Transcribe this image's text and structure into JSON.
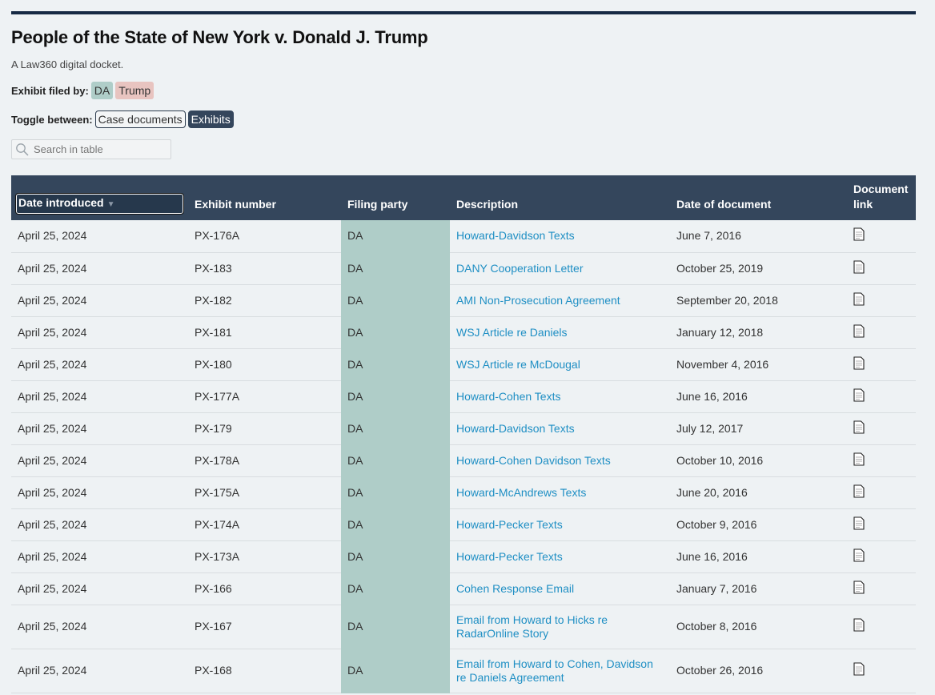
{
  "header": {
    "title": "People of the State of New York v. Donald J. Trump",
    "subtitle": "A Law360 digital docket."
  },
  "legend": {
    "label": "Exhibit filed by:",
    "chips": [
      {
        "label": "DA",
        "color": "#afcdc8"
      },
      {
        "label": "Trump",
        "color": "#e8c4c0"
      }
    ]
  },
  "toggle": {
    "label": "Toggle between:",
    "options": [
      "Case documents",
      "Exhibits"
    ],
    "selected": "Exhibits"
  },
  "search": {
    "placeholder": "Search in table",
    "value": ""
  },
  "table": {
    "columns": [
      "Date introduced",
      "Exhibit number",
      "Filing party",
      "Description",
      "Date of document",
      "Document link"
    ],
    "sort_column": "Date introduced",
    "sort_direction": "descending",
    "rows": [
      {
        "date_introduced": "April 25, 2024",
        "exhibit": "PX-176A",
        "party": "DA",
        "description": "Howard-Davidson Texts",
        "doc_date": "June 7, 2016"
      },
      {
        "date_introduced": "April 25, 2024",
        "exhibit": "PX-183",
        "party": "DA",
        "description": "DANY Cooperation Letter",
        "doc_date": "October 25, 2019"
      },
      {
        "date_introduced": "April 25, 2024",
        "exhibit": "PX-182",
        "party": "DA",
        "description": "AMI Non-Prosecution Agreement",
        "doc_date": "September 20, 2018"
      },
      {
        "date_introduced": "April 25, 2024",
        "exhibit": "PX-181",
        "party": "DA",
        "description": "WSJ Article re Daniels",
        "doc_date": "January 12, 2018"
      },
      {
        "date_introduced": "April 25, 2024",
        "exhibit": "PX-180",
        "party": "DA",
        "description": "WSJ Article re McDougal",
        "doc_date": "November 4, 2016"
      },
      {
        "date_introduced": "April 25, 2024",
        "exhibit": "PX-177A",
        "party": "DA",
        "description": "Howard-Cohen Texts",
        "doc_date": "June 16, 2016"
      },
      {
        "date_introduced": "April 25, 2024",
        "exhibit": "PX-179",
        "party": "DA",
        "description": "Howard-Davidson Texts",
        "doc_date": "July 12, 2017"
      },
      {
        "date_introduced": "April 25, 2024",
        "exhibit": "PX-178A",
        "party": "DA",
        "description": "Howard-Cohen Davidson Texts",
        "doc_date": "October 10, 2016"
      },
      {
        "date_introduced": "April 25, 2024",
        "exhibit": "PX-175A",
        "party": "DA",
        "description": "Howard-McAndrews Texts",
        "doc_date": "June 20, 2016"
      },
      {
        "date_introduced": "April 25, 2024",
        "exhibit": "PX-174A",
        "party": "DA",
        "description": "Howard-Pecker Texts",
        "doc_date": "October 9, 2016"
      },
      {
        "date_introduced": "April 25, 2024",
        "exhibit": "PX-173A",
        "party": "DA",
        "description": "Howard-Pecker Texts",
        "doc_date": "June 16, 2016"
      },
      {
        "date_introduced": "April 25, 2024",
        "exhibit": "PX-166",
        "party": "DA",
        "description": "Cohen Response Email",
        "doc_date": "January 7, 2016"
      },
      {
        "date_introduced": "April 25, 2024",
        "exhibit": "PX-167",
        "party": "DA",
        "description": "Email from Howard to Hicks re RadarOnline Story",
        "doc_date": "October 8, 2016"
      },
      {
        "date_introduced": "April 25, 2024",
        "exhibit": "PX-168",
        "party": "DA",
        "description": "Email from Howard to Cohen, Davidson re Daniels Agreement",
        "doc_date": "October 26, 2016"
      }
    ],
    "doc_link_icon": "document-icon"
  },
  "colors": {
    "topbar": "#162a44",
    "header_bg": "#34465c",
    "da": "#afcdc8",
    "trump": "#e8c4c0",
    "link": "#1f8fc4",
    "page_bg": "#eef2f4"
  }
}
